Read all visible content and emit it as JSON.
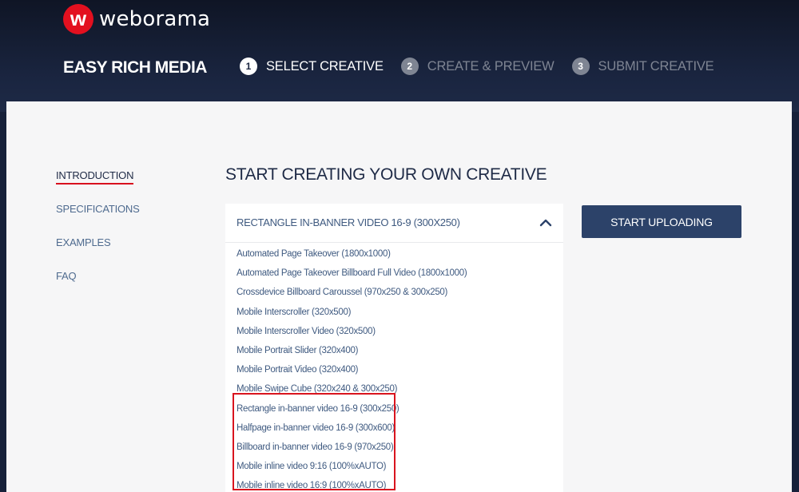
{
  "brand": {
    "logo_letter": "w",
    "name": "weborama",
    "accent_color": "#e3101f"
  },
  "app_title": "EASY RICH MEDIA",
  "steps": [
    {
      "number": "1",
      "label": "SELECT CREATIVE",
      "active": true
    },
    {
      "number": "2",
      "label": "CREATE & PREVIEW",
      "active": false
    },
    {
      "number": "3",
      "label": "SUBMIT CREATIVE",
      "active": false
    }
  ],
  "sidebar": {
    "items": [
      {
        "label": "INTRODUCTION",
        "active": true
      },
      {
        "label": "SPECIFICATIONS",
        "active": false
      },
      {
        "label": "EXAMPLES",
        "active": false
      },
      {
        "label": "FAQ",
        "active": false
      }
    ]
  },
  "main": {
    "title": "START CREATING YOUR OWN CREATIVE",
    "format_select": {
      "selected": "RECTANGLE IN-BANNER VIDEO 16-9 (300X250)",
      "expanded": true,
      "icon": "chevron-up-icon",
      "options": [
        "Automated Page Takeover (1800x1000)",
        "Automated Page Takeover Billboard Full Video (1800x1000)",
        "Crossdevice Billboard Caroussel (970x250 & 300x250)",
        "Mobile Interscroller (320x500)",
        "Mobile Interscroller Video (320x500)",
        "Mobile Portrait Slider (320x400)",
        "Mobile Portrait Video (320x400)",
        "Mobile Swipe Cube (320x240 & 300x250)",
        "Rectangle in-banner video 16-9 (300x250)",
        "Halfpage in-banner video 16-9 (300x600)",
        "Billboard in-banner video 16-9 (970x250)",
        "Mobile inline video 9:16 (100%xAUTO)",
        "Mobile inline video 16:9 (100%xAUTO)"
      ]
    },
    "upload_button_label": "START UPLOADING"
  },
  "colors": {
    "header_bg": "#1a2540",
    "button_bg": "#2c4269",
    "text_blue": "#3f5a80",
    "highlight_red": "#d9141e"
  }
}
